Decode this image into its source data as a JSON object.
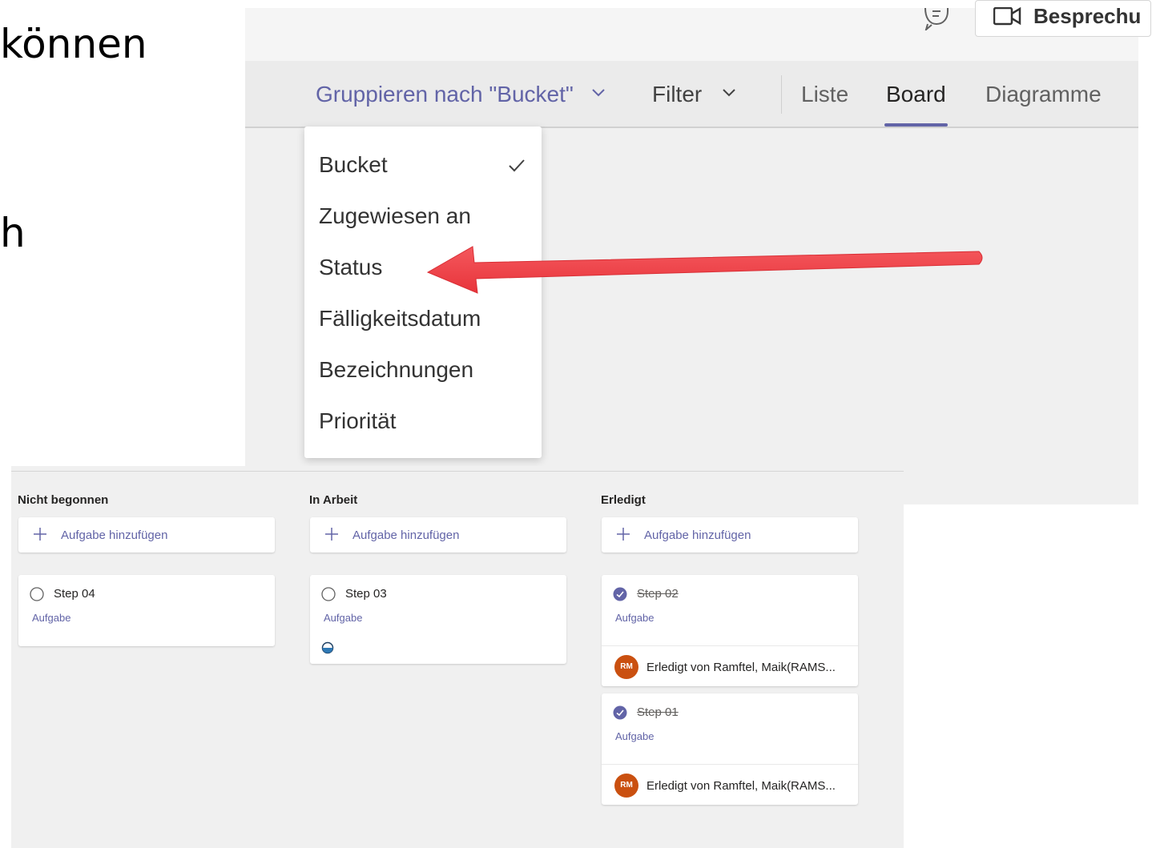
{
  "slide": {
    "line1": "können",
    "line2": "h"
  },
  "header": {
    "chat_icon": "chat-icon",
    "meeting_button_label": "Besprechu",
    "meeting_icon": "video-camera-icon"
  },
  "toolbar": {
    "group_by_label": "Gruppieren nach \"Bucket\"",
    "filter_label": "Filter",
    "views": [
      {
        "label": "Liste",
        "active": false
      },
      {
        "label": "Board",
        "active": true
      },
      {
        "label": "Diagramme",
        "active": false
      }
    ],
    "accent_color": "#6264a7"
  },
  "group_by_menu": {
    "selected": "Bucket",
    "items": [
      "Bucket",
      "Zugewiesen an",
      "Status",
      "Fälligkeitsdatum",
      "Bezeichnungen",
      "Priorität"
    ]
  },
  "annotation": {
    "arrow_color": "#f2474d",
    "points_to": "Status"
  },
  "board": {
    "add_task_label": "Aufgabe hinzufügen",
    "columns": [
      {
        "title": "Nicht begonnen",
        "cards": [
          {
            "title": "Step 04",
            "bucket": "Aufgabe",
            "completed": false
          }
        ]
      },
      {
        "title": "In Arbeit",
        "cards": [
          {
            "title": "Step 03",
            "bucket": "Aufgabe",
            "completed": false,
            "progress": "in-progress"
          }
        ]
      },
      {
        "title": "Erledigt",
        "cards": [
          {
            "title": "Step 02",
            "bucket": "Aufgabe",
            "completed": true,
            "completed_by_initials": "RM",
            "completed_by_text": "Erledigt von Ramftel, Maik(RAMS..."
          },
          {
            "title": "Step 01",
            "bucket": "Aufgabe",
            "completed": true,
            "completed_by_initials": "RM",
            "completed_by_text": "Erledigt von Ramftel, Maik(RAMS..."
          }
        ]
      }
    ]
  }
}
